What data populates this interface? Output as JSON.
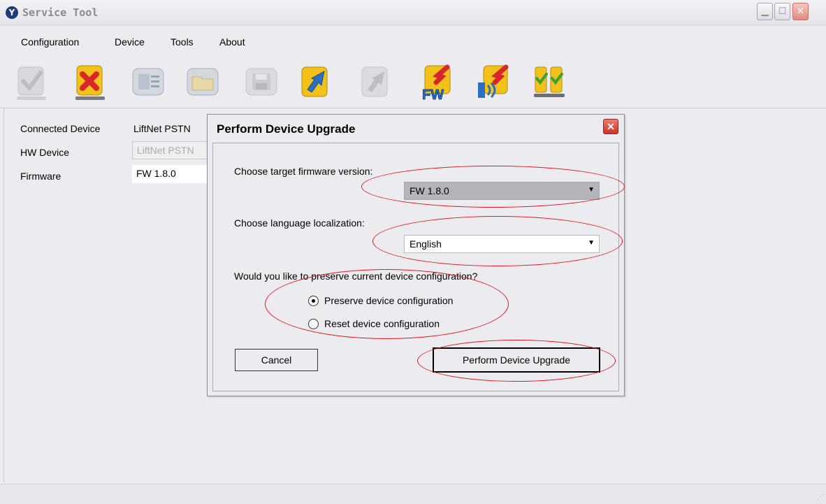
{
  "window": {
    "title": "Service Tool",
    "logo_glyph": "Y",
    "controls": {
      "minimize": "▁",
      "maximize": "☐",
      "close": "✕"
    }
  },
  "menu": {
    "items": [
      "Configuration",
      "Device",
      "Tools",
      "About"
    ]
  },
  "toolbar": {
    "icons": [
      "connect-icon",
      "disconnect-icon",
      "device-info-icon",
      "open-folder-icon",
      "save-icon",
      "upload-icon",
      "download-icon",
      "firmware-upgrade-icon",
      "audio-upgrade-icon",
      "test-icon"
    ],
    "fw_text": "FW"
  },
  "device_panel": {
    "connected_label": "Connected Device",
    "connected_value": "LiftNet PSTN",
    "hw_label": "HW Device",
    "hw_value": "LiftNet PSTN",
    "firmware_label": "Firmware",
    "firmware_value": "FW 1.8.0"
  },
  "dialog": {
    "title": "Perform Device Upgrade",
    "close_glyph": "✕",
    "firmware_prompt": "Choose target firmware version:",
    "firmware_selected": "FW 1.8.0",
    "language_prompt": "Choose language localization:",
    "language_selected": "English",
    "preserve_prompt": "Would you like to preserve current device configuration?",
    "option_preserve": "Preserve device configuration",
    "option_reset": "Reset device configuration",
    "selected_option": "preserve",
    "cancel_label": "Cancel",
    "upgrade_label": "Perform Device Upgrade",
    "dropdown_arrow": "▼"
  },
  "colors": {
    "annotation": "#e01818",
    "accent_yellow": "#f2c21a",
    "accent_red": "#d8262b",
    "accent_blue": "#2c6fc2"
  }
}
